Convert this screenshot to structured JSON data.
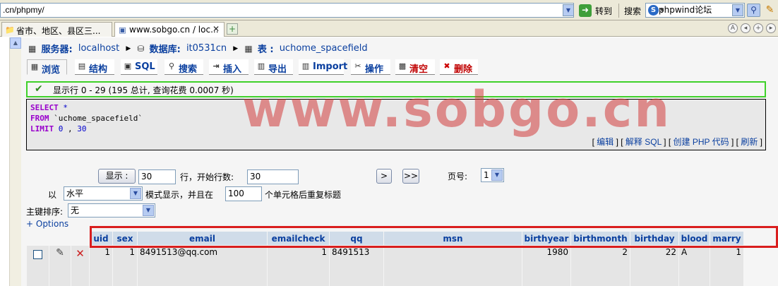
{
  "browser": {
    "address": ".cn/phpmy/",
    "go_label": "转到",
    "search_label": "搜索",
    "search_engine_logo": "S",
    "search_value": "phpwind论坛",
    "tabs": [
      {
        "label": "省市、地区、县区三...",
        "icon": "folder-icon"
      },
      {
        "label": "www.sobgo.cn / loc...",
        "icon": "page-icon"
      }
    ]
  },
  "breadcrumb": {
    "server_label": "服务器:",
    "server": "localhost",
    "db_label": "数据库:",
    "db": "it0531cn",
    "table_label": "表 :",
    "table": "uchome_spacefield"
  },
  "tabs": [
    {
      "label": "浏览",
      "icon": "▦",
      "name": "tab-browse",
      "active": true
    },
    {
      "label": "结构",
      "icon": "▤",
      "name": "tab-structure"
    },
    {
      "label": "SQL",
      "icon": "▣",
      "name": "tab-sql"
    },
    {
      "label": "搜索",
      "icon": "⚲",
      "name": "tab-search"
    },
    {
      "label": "插入",
      "icon": "⇥",
      "name": "tab-insert"
    },
    {
      "label": "导出",
      "icon": "▥",
      "name": "tab-export"
    },
    {
      "label": "Import",
      "icon": "▥",
      "name": "tab-import"
    },
    {
      "label": "操作",
      "icon": "✂",
      "name": "tab-operations"
    },
    {
      "label": "清空",
      "icon": "▩",
      "name": "tab-empty",
      "danger": true
    },
    {
      "label": "删除",
      "icon": "✖",
      "name": "tab-drop",
      "danger": true
    }
  ],
  "status": {
    "message": "显示行 0 - 29 (195 总计, 查询花费 0.0007 秒)"
  },
  "sql": {
    "line1_kw": "SELECT",
    "line1_rest": " *",
    "line2_kw": "FROM",
    "line2_rest": " `uchome_spacefield`",
    "line3_kw": "LIMIT",
    "line3_a": " 0",
    "line3_sep": " , ",
    "line3_b": "30",
    "links": {
      "edit": "编辑",
      "explain": "解释 SQL",
      "php": "创建 PHP 代码",
      "refresh": "刷新"
    }
  },
  "watermark": "www.sobgo.cn",
  "nav": {
    "show_button": "显示 :",
    "rows_value": "30",
    "rows_suffix": "行，开始行数:",
    "start_value": "30",
    "next_button": ">",
    "last_button": ">>",
    "page_label": "页号:",
    "page_value": "1",
    "mode_prefix": "以",
    "mode_value": "水平",
    "mode_suffix": "模式显示，并且在",
    "repeat_value": "100",
    "repeat_suffix": "个单元格后重复标题",
    "sort_label": "主键排序:",
    "sort_value": "无",
    "options_link": "+ Options"
  },
  "table": {
    "columns": [
      "uid",
      "sex",
      "email",
      "emailcheck",
      "qq",
      "msn",
      "birthyear",
      "birthmonth",
      "birthday",
      "blood",
      "marry"
    ],
    "rows": [
      {
        "uid": "1",
        "sex": "1",
        "email": "8491513@qq.com",
        "emailcheck": "1",
        "qq": "8491513",
        "msn": "",
        "birthyear": "1980",
        "birthmonth": "2",
        "birthday": "22",
        "blood": "A",
        "marry": "1"
      }
    ]
  }
}
